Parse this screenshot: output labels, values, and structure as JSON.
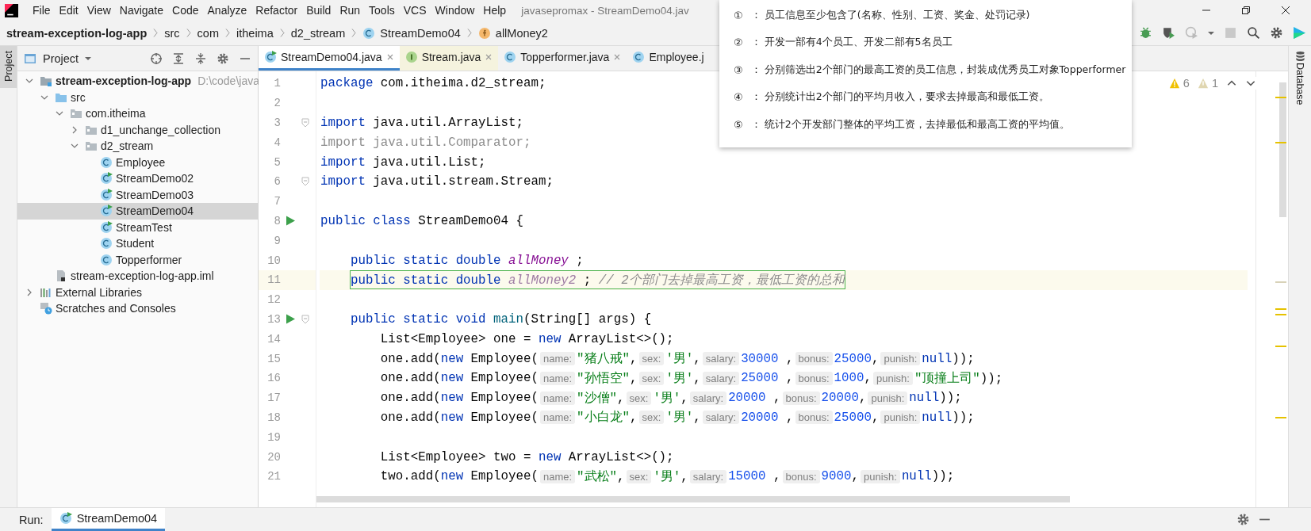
{
  "menu": [
    "File",
    "Edit",
    "View",
    "Navigate",
    "Code",
    "Analyze",
    "Refactor",
    "Build",
    "Run",
    "Tools",
    "VCS",
    "Window",
    "Help"
  ],
  "window_title": "javasepromax - StreamDemo04.jav",
  "breadcrumbs": [
    {
      "label": "stream-exception-log-app",
      "kind": "project"
    },
    {
      "label": "src",
      "kind": "folder"
    },
    {
      "label": "com",
      "kind": "folder"
    },
    {
      "label": "itheima",
      "kind": "folder"
    },
    {
      "label": "d2_stream",
      "kind": "folder"
    },
    {
      "label": "StreamDemo04",
      "kind": "class"
    },
    {
      "label": "allMoney2",
      "kind": "field"
    }
  ],
  "left_strip": "Project",
  "right_strip": "Database",
  "project": {
    "title": "Project",
    "tree": [
      {
        "label": "stream-exception-log-app",
        "note": "D:\\code\\java",
        "kind": "module",
        "expanded": true,
        "selected": false,
        "children": [
          {
            "label": "src",
            "kind": "source",
            "expanded": true,
            "selected": false,
            "children": [
              {
                "label": "com.itheima",
                "kind": "package",
                "expanded": true,
                "selected": false,
                "children": [
                  {
                    "label": "d1_unchange_collection",
                    "kind": "package",
                    "expanded": false,
                    "selected": false
                  },
                  {
                    "label": "d2_stream",
                    "kind": "package",
                    "expanded": true,
                    "selected": false,
                    "children": [
                      {
                        "label": "Employee",
                        "kind": "class",
                        "selected": false
                      },
                      {
                        "label": "StreamDemo02",
                        "kind": "runnable",
                        "selected": false
                      },
                      {
                        "label": "StreamDemo03",
                        "kind": "runnable",
                        "selected": false
                      },
                      {
                        "label": "StreamDemo04",
                        "kind": "runnable",
                        "selected": true
                      },
                      {
                        "label": "StreamTest",
                        "kind": "runnable",
                        "selected": false
                      },
                      {
                        "label": "Student",
                        "kind": "class",
                        "selected": false
                      },
                      {
                        "label": "Topperformer",
                        "kind": "class",
                        "selected": false
                      }
                    ]
                  }
                ]
              }
            ]
          },
          {
            "label": "stream-exception-log-app.iml",
            "kind": "file",
            "selected": false
          }
        ]
      },
      {
        "label": "External Libraries",
        "kind": "libraries",
        "expanded": false,
        "selected": false
      },
      {
        "label": "Scratches and Consoles",
        "kind": "scratches",
        "selected": false
      }
    ]
  },
  "tabs": [
    {
      "label": "StreamDemo04.java",
      "kind": "runnable",
      "selected": true
    },
    {
      "label": "Stream.java",
      "kind": "interface",
      "selected": false
    },
    {
      "label": "Topperformer.java",
      "kind": "class",
      "selected": false
    },
    {
      "label": "Employee.j",
      "kind": "class",
      "selected": false
    }
  ],
  "inspections": {
    "warnings": "6",
    "weak_warnings": "1"
  },
  "code": [
    {
      "n": "1",
      "run": false,
      "fold": false,
      "current": false,
      "tokens": [
        {
          "kind": "kw",
          "text": "package"
        },
        {
          "kind": "plain",
          "text": " com.itheima.d2_stream;"
        }
      ]
    },
    {
      "n": "2",
      "run": false,
      "fold": false,
      "current": false
    },
    {
      "n": "3",
      "run": false,
      "fold": true,
      "current": false,
      "tokens": [
        {
          "kind": "kw",
          "text": "import"
        },
        {
          "kind": "plain",
          "text": " java.util.ArrayList;"
        }
      ]
    },
    {
      "n": "4",
      "run": false,
      "fold": false,
      "current": false,
      "tokens": [
        {
          "kind": "unused",
          "text": "import java.util.Comparator;"
        }
      ]
    },
    {
      "n": "5",
      "run": false,
      "fold": false,
      "current": false,
      "tokens": [
        {
          "kind": "kw",
          "text": "import"
        },
        {
          "kind": "plain",
          "text": " java.util.List;"
        }
      ]
    },
    {
      "n": "6",
      "run": false,
      "fold": true,
      "current": false,
      "tokens": [
        {
          "kind": "kw",
          "text": "import"
        },
        {
          "kind": "plain",
          "text": " java.util.stream.Stream;"
        }
      ]
    },
    {
      "n": "7",
      "run": false,
      "fold": false,
      "current": false
    },
    {
      "n": "8",
      "run": true,
      "fold": false,
      "current": false,
      "tokens": [
        {
          "kind": "kw",
          "text": "public class"
        },
        {
          "kind": "plain",
          "text": " StreamDemo04 {"
        }
      ]
    },
    {
      "n": "9",
      "run": false,
      "fold": false,
      "current": false
    },
    {
      "n": "10",
      "run": false,
      "fold": false,
      "current": false,
      "tokens": [
        {
          "kind": "kw",
          "text": "    public static double "
        },
        {
          "kind": "field",
          "text": "allMoney"
        },
        {
          "kind": "plain",
          "text": " ;"
        }
      ]
    },
    {
      "n": "11",
      "run": false,
      "fold": false,
      "current": true,
      "tokens": [
        {
          "kind": "kw",
          "text": "    public static double "
        },
        {
          "kind": "unused_field",
          "text": "allMoney2"
        },
        {
          "kind": "plain",
          "text": " ; "
        },
        {
          "kind": "comment",
          "text": "// 2个部门去掉最高工资，最低工资的总和"
        }
      ]
    },
    {
      "n": "12",
      "run": false,
      "fold": false,
      "current": false
    },
    {
      "n": "13",
      "run": true,
      "fold": true,
      "current": false,
      "tokens": [
        {
          "kind": "kw",
          "text": "    public static void "
        },
        {
          "kind": "method",
          "text": "main"
        },
        {
          "kind": "plain",
          "text": "(String[] args) {"
        }
      ]
    },
    {
      "n": "14",
      "run": false,
      "fold": false,
      "current": false,
      "tokens": [
        {
          "kind": "plain",
          "text": "        List<Employee> one = "
        },
        {
          "kind": "kw",
          "text": "new"
        },
        {
          "kind": "plain",
          "text": " ArrayList<>();"
        }
      ]
    },
    {
      "n": "15",
      "run": false,
      "fold": false,
      "current": false,
      "tokens": [
        {
          "kind": "plain",
          "text": "        one.add("
        },
        {
          "kind": "kw",
          "text": "new"
        },
        {
          "kind": "plain",
          "text": " Employee("
        },
        {
          "kind": "hint",
          "text": "name:"
        },
        {
          "kind": "str",
          "text": "\"猪八戒\""
        },
        {
          "kind": "plain",
          "text": ","
        },
        {
          "kind": "hint",
          "text": "sex:"
        },
        {
          "kind": "str",
          "text": "'男'"
        },
        {
          "kind": "plain",
          "text": ","
        },
        {
          "kind": "hint",
          "text": "salary:"
        },
        {
          "kind": "num",
          "text": "30000"
        },
        {
          "kind": "plain",
          "text": " ,"
        },
        {
          "kind": "hint",
          "text": "bonus:"
        },
        {
          "kind": "num",
          "text": "25000"
        },
        {
          "kind": "plain",
          "text": ","
        },
        {
          "kind": "hint",
          "text": "punish:"
        },
        {
          "kind": "kw",
          "text": "null"
        },
        {
          "kind": "plain",
          "text": "));"
        }
      ]
    },
    {
      "n": "16",
      "run": false,
      "fold": false,
      "current": false,
      "tokens": [
        {
          "kind": "plain",
          "text": "        one.add("
        },
        {
          "kind": "kw",
          "text": "new"
        },
        {
          "kind": "plain",
          "text": " Employee("
        },
        {
          "kind": "hint",
          "text": "name:"
        },
        {
          "kind": "str",
          "text": "\"孙悟空\""
        },
        {
          "kind": "plain",
          "text": ","
        },
        {
          "kind": "hint",
          "text": "sex:"
        },
        {
          "kind": "str",
          "text": "'男'"
        },
        {
          "kind": "plain",
          "text": ","
        },
        {
          "kind": "hint",
          "text": "salary:"
        },
        {
          "kind": "num",
          "text": "25000"
        },
        {
          "kind": "plain",
          "text": " ,"
        },
        {
          "kind": "hint",
          "text": "bonus:"
        },
        {
          "kind": "num",
          "text": "1000"
        },
        {
          "kind": "plain",
          "text": ","
        },
        {
          "kind": "hint",
          "text": "punish:"
        },
        {
          "kind": "str",
          "text": "\"顶撞上司\""
        },
        {
          "kind": "plain",
          "text": "));"
        }
      ]
    },
    {
      "n": "17",
      "run": false,
      "fold": false,
      "current": false,
      "tokens": [
        {
          "kind": "plain",
          "text": "        one.add("
        },
        {
          "kind": "kw",
          "text": "new"
        },
        {
          "kind": "plain",
          "text": " Employee("
        },
        {
          "kind": "hint",
          "text": "name:"
        },
        {
          "kind": "str",
          "text": "\"沙僧\""
        },
        {
          "kind": "plain",
          "text": ","
        },
        {
          "kind": "hint",
          "text": "sex:"
        },
        {
          "kind": "str",
          "text": "'男'"
        },
        {
          "kind": "plain",
          "text": ","
        },
        {
          "kind": "hint",
          "text": "salary:"
        },
        {
          "kind": "num",
          "text": "20000"
        },
        {
          "kind": "plain",
          "text": " ,"
        },
        {
          "kind": "hint",
          "text": "bonus:"
        },
        {
          "kind": "num",
          "text": "20000"
        },
        {
          "kind": "plain",
          "text": ","
        },
        {
          "kind": "hint",
          "text": "punish:"
        },
        {
          "kind": "kw",
          "text": "null"
        },
        {
          "kind": "plain",
          "text": "));"
        }
      ]
    },
    {
      "n": "18",
      "run": false,
      "fold": false,
      "current": false,
      "tokens": [
        {
          "kind": "plain",
          "text": "        one.add("
        },
        {
          "kind": "kw",
          "text": "new"
        },
        {
          "kind": "plain",
          "text": " Employee("
        },
        {
          "kind": "hint",
          "text": "name:"
        },
        {
          "kind": "str",
          "text": "\"小白龙\""
        },
        {
          "kind": "plain",
          "text": ","
        },
        {
          "kind": "hint",
          "text": "sex:"
        },
        {
          "kind": "str",
          "text": "'男'"
        },
        {
          "kind": "plain",
          "text": ","
        },
        {
          "kind": "hint",
          "text": "salary:"
        },
        {
          "kind": "num",
          "text": "20000"
        },
        {
          "kind": "plain",
          "text": " ,"
        },
        {
          "kind": "hint",
          "text": "bonus:"
        },
        {
          "kind": "num",
          "text": "25000"
        },
        {
          "kind": "plain",
          "text": ","
        },
        {
          "kind": "hint",
          "text": "punish:"
        },
        {
          "kind": "kw",
          "text": "null"
        },
        {
          "kind": "plain",
          "text": "));"
        }
      ]
    },
    {
      "n": "19",
      "run": false,
      "fold": false,
      "current": false
    },
    {
      "n": "20",
      "run": false,
      "fold": false,
      "current": false,
      "tokens": [
        {
          "kind": "plain",
          "text": "        List<Employee> two = "
        },
        {
          "kind": "kw",
          "text": "new"
        },
        {
          "kind": "plain",
          "text": " ArrayList<>();"
        }
      ]
    },
    {
      "n": "21",
      "run": false,
      "fold": false,
      "current": false,
      "tokens": [
        {
          "kind": "plain",
          "text": "        two.add("
        },
        {
          "kind": "kw",
          "text": "new"
        },
        {
          "kind": "plain",
          "text": " Employee("
        },
        {
          "kind": "hint",
          "text": "name:"
        },
        {
          "kind": "str",
          "text": "\"武松\""
        },
        {
          "kind": "plain",
          "text": ","
        },
        {
          "kind": "hint",
          "text": "sex:"
        },
        {
          "kind": "str",
          "text": "'男'"
        },
        {
          "kind": "plain",
          "text": ","
        },
        {
          "kind": "hint",
          "text": "salary:"
        },
        {
          "kind": "num",
          "text": "15000"
        },
        {
          "kind": "plain",
          "text": " ,"
        },
        {
          "kind": "hint",
          "text": "bonus:"
        },
        {
          "kind": "num",
          "text": "9000"
        },
        {
          "kind": "plain",
          "text": ","
        },
        {
          "kind": "hint",
          "text": "punish:"
        },
        {
          "kind": "kw",
          "text": "null"
        },
        {
          "kind": "plain",
          "text": "));"
        }
      ]
    }
  ],
  "popup": [
    {
      "marker": "①",
      "text": "： 员工信息至少包含了(名称、性别、工资、奖金、处罚记录)"
    },
    {
      "marker": "②",
      "text": "： 开发一部有4个员工、开发二部有5名员工"
    },
    {
      "marker": "③",
      "text": "： 分别筛选出2个部门的最高工资的员工信息，封装成优秀员工对象Topperformer"
    },
    {
      "marker": "④",
      "text": "： 分别统计出2个部门的平均月收入，要求去掉最高和最低工资。"
    },
    {
      "marker": "⑤",
      "text": "： 统计2个开发部门整体的平均工资，去掉最低和最高工资的平均值。"
    }
  ],
  "run_bar": {
    "label": "Run:",
    "tab": "StreamDemo04"
  }
}
